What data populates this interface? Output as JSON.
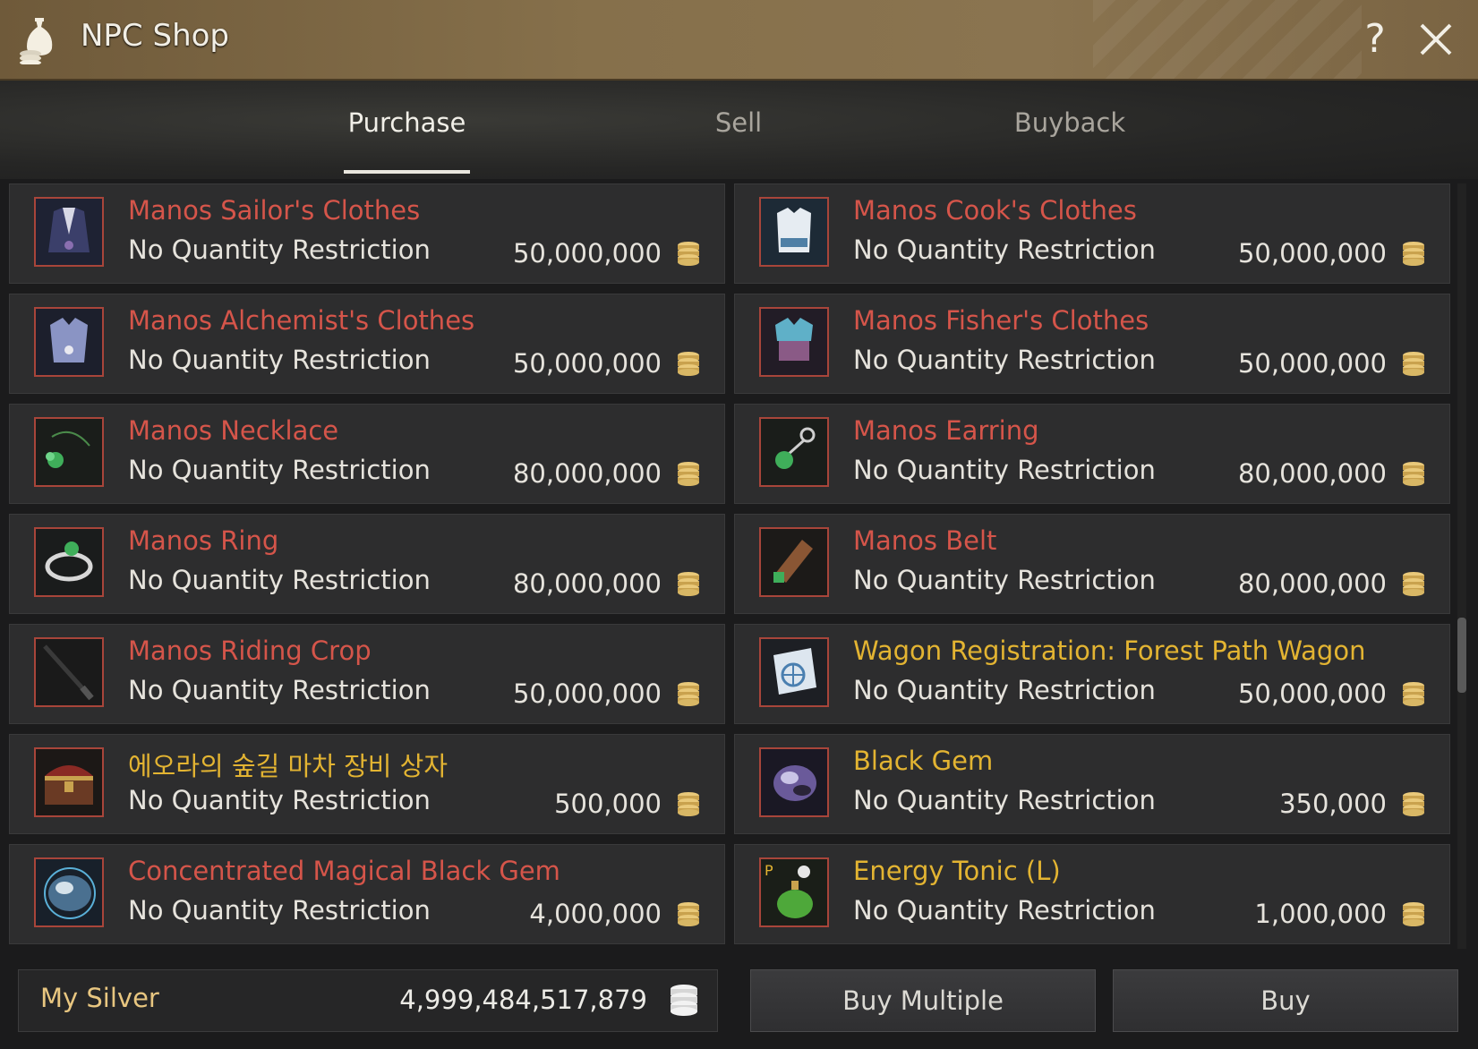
{
  "window": {
    "title": "NPC Shop",
    "help_icon": "?"
  },
  "tabs": [
    {
      "label": "Purchase",
      "active": true
    },
    {
      "label": "Sell",
      "active": false
    },
    {
      "label": "Buyback",
      "active": false
    }
  ],
  "items": [
    {
      "name": "Manos Sailor's Clothes",
      "restriction": "No Quantity Restriction",
      "price": "50,000,000",
      "name_color": "red",
      "icon": "sailor-clothes-icon"
    },
    {
      "name": "Manos Cook's Clothes",
      "restriction": "No Quantity Restriction",
      "price": "50,000,000",
      "name_color": "red",
      "icon": "cook-clothes-icon"
    },
    {
      "name": "Manos Alchemist's Clothes",
      "restriction": "No Quantity Restriction",
      "price": "50,000,000",
      "name_color": "red",
      "icon": "alchemist-clothes-icon"
    },
    {
      "name": "Manos Fisher's Clothes",
      "restriction": "No Quantity Restriction",
      "price": "50,000,000",
      "name_color": "red",
      "icon": "fisher-clothes-icon"
    },
    {
      "name": "Manos Necklace",
      "restriction": "No Quantity Restriction",
      "price": "80,000,000",
      "name_color": "red",
      "icon": "necklace-icon"
    },
    {
      "name": "Manos Earring",
      "restriction": "No Quantity Restriction",
      "price": "80,000,000",
      "name_color": "red",
      "icon": "earring-icon"
    },
    {
      "name": "Manos Ring",
      "restriction": "No Quantity Restriction",
      "price": "80,000,000",
      "name_color": "red",
      "icon": "ring-icon"
    },
    {
      "name": "Manos Belt",
      "restriction": "No Quantity Restriction",
      "price": "80,000,000",
      "name_color": "red",
      "icon": "belt-icon"
    },
    {
      "name": "Manos Riding Crop",
      "restriction": "No Quantity Restriction",
      "price": "50,000,000",
      "name_color": "red",
      "icon": "riding-crop-icon"
    },
    {
      "name": "Wagon Registration: Forest Path Wagon",
      "restriction": "No Quantity Restriction",
      "price": "50,000,000",
      "name_color": "gold",
      "icon": "wagon-registration-icon"
    },
    {
      "name": "에오라의 숲길 마차 장비 상자",
      "restriction": "No Quantity Restriction",
      "price": "500,000",
      "name_color": "gold",
      "icon": "treasure-chest-icon"
    },
    {
      "name": "Black Gem",
      "restriction": "No Quantity Restriction",
      "price": "350,000",
      "name_color": "gold",
      "icon": "black-gem-icon"
    },
    {
      "name": "Concentrated Magical Black Gem",
      "restriction": "No Quantity Restriction",
      "price": "4,000,000",
      "name_color": "red",
      "icon": "magical-black-gem-icon"
    },
    {
      "name": "Energy Tonic (L)",
      "restriction": "No Quantity Restriction",
      "price": "1,000,000",
      "name_color": "gold",
      "icon": "energy-tonic-icon"
    }
  ],
  "footer": {
    "silver_label": "My Silver",
    "silver_value": "4,999,484,517,879",
    "buy_multiple_label": "Buy Multiple",
    "buy_label": "Buy"
  },
  "colors": {
    "name_red": "#d5554a",
    "name_gold": "#e3b432",
    "titlebar": "#86704b",
    "icon_border": "#a8453a"
  }
}
